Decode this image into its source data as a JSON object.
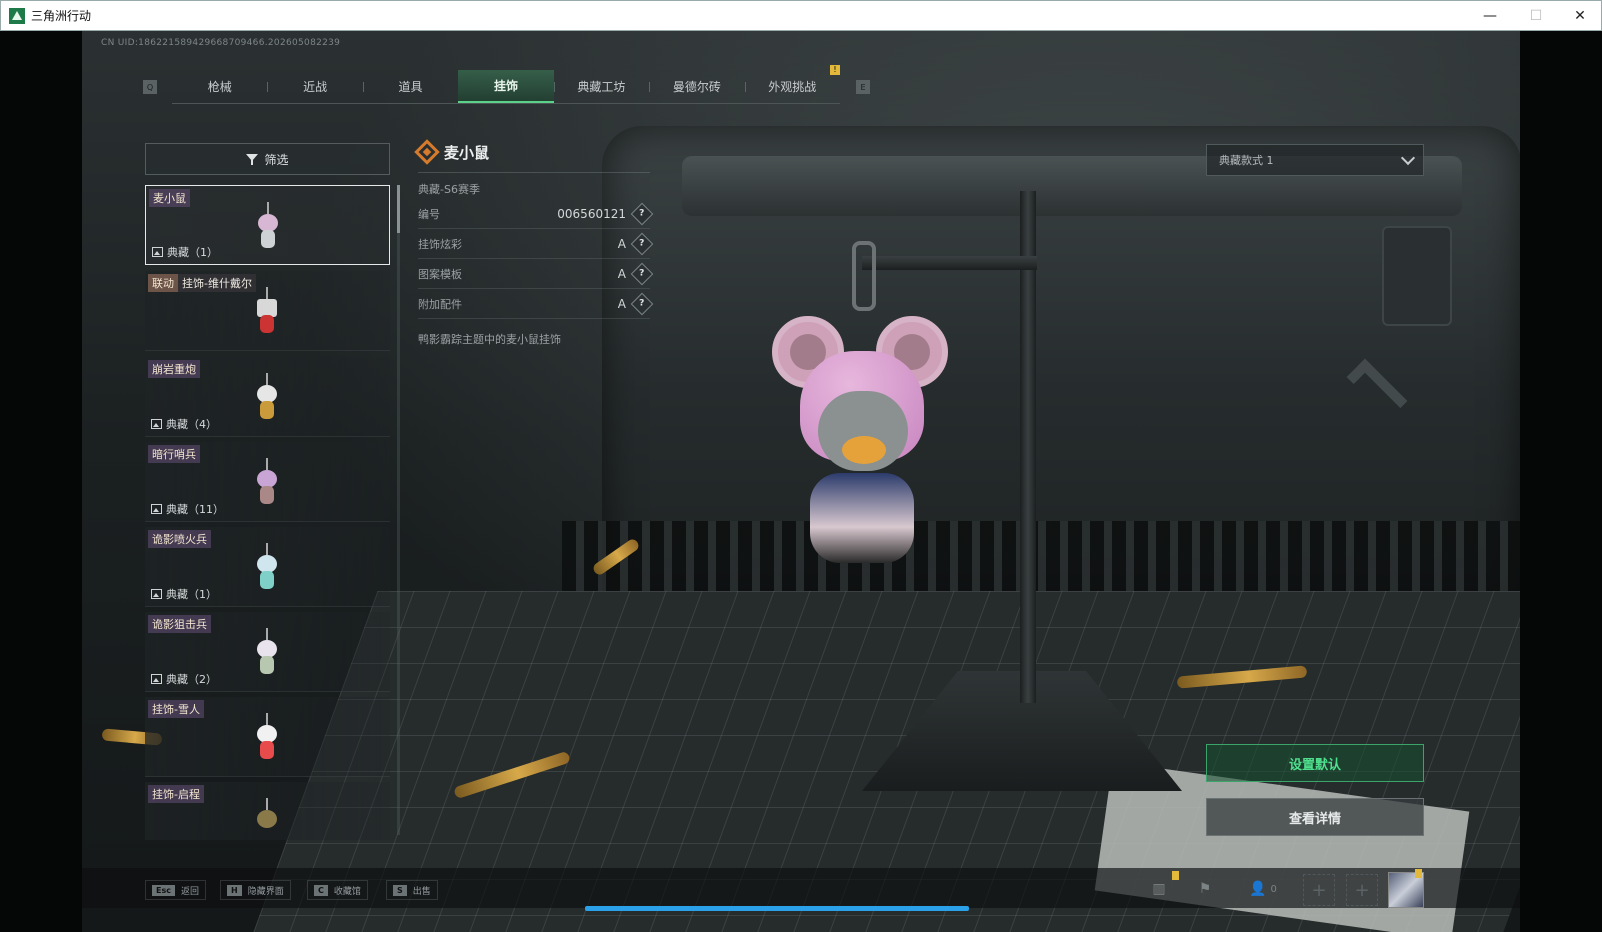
{
  "window": {
    "title": "三角洲行动",
    "min": "—",
    "max": "☐",
    "close": "✕"
  },
  "uid": "CN UID:186221589429668709466.202605082239",
  "tabs": [
    {
      "label": "枪械"
    },
    {
      "label": "近战"
    },
    {
      "label": "道具"
    },
    {
      "label": "挂饰",
      "active": true
    },
    {
      "label": "典藏工坊"
    },
    {
      "label": "曼德尔砖"
    },
    {
      "label": "外观挑战",
      "notice": true
    }
  ],
  "tab_keys": {
    "prev": "Q",
    "next": "E"
  },
  "filter_label": "筛选",
  "items": [
    {
      "name": "麦小鼠",
      "tag": "",
      "count": "典藏（1）"
    },
    {
      "name": "挂饰-维什戴尔",
      "tag": "联动",
      "count": ""
    },
    {
      "name": "崩岩重炮",
      "tag": "",
      "count": "典藏（4）"
    },
    {
      "name": "暗行哨兵",
      "tag": "",
      "count": "典藏（11）"
    },
    {
      "name": "诡影喷火兵",
      "tag": "",
      "count": "典藏（1）"
    },
    {
      "name": "诡影狙击兵",
      "tag": "",
      "count": "典藏（2）"
    },
    {
      "name": "挂饰-雪人",
      "tag": "",
      "count": ""
    },
    {
      "name": "挂饰-启程",
      "tag": "",
      "count": ""
    }
  ],
  "detail": {
    "title": "麦小鼠",
    "season": "典藏-S6赛季",
    "props": [
      {
        "label": "编号",
        "value": "006560121"
      },
      {
        "label": "挂饰炫彩",
        "value": "A"
      },
      {
        "label": "图案模板",
        "value": "A"
      },
      {
        "label": "附加配件",
        "value": "A"
      }
    ],
    "help_glyph": "?",
    "description": "鸭影霸踪主题中的麦小鼠挂饰"
  },
  "style_select": "典藏款式 1",
  "buttons": {
    "set_default": "设置默认",
    "view_detail": "查看详情"
  },
  "hints": [
    {
      "key": "Esc",
      "label": "返回"
    },
    {
      "key": "H",
      "label": "隐藏界面"
    },
    {
      "key": "C",
      "label": "收藏馆"
    },
    {
      "key": "S",
      "label": "出售"
    }
  ],
  "hud": {
    "friends_count": "0",
    "plus": "+"
  },
  "colors": {
    "accent_green": "#4fe08e",
    "tab_active": "#5cd18a",
    "tag_brown": "#96705a",
    "notice_yellow": "#e2b93b"
  }
}
